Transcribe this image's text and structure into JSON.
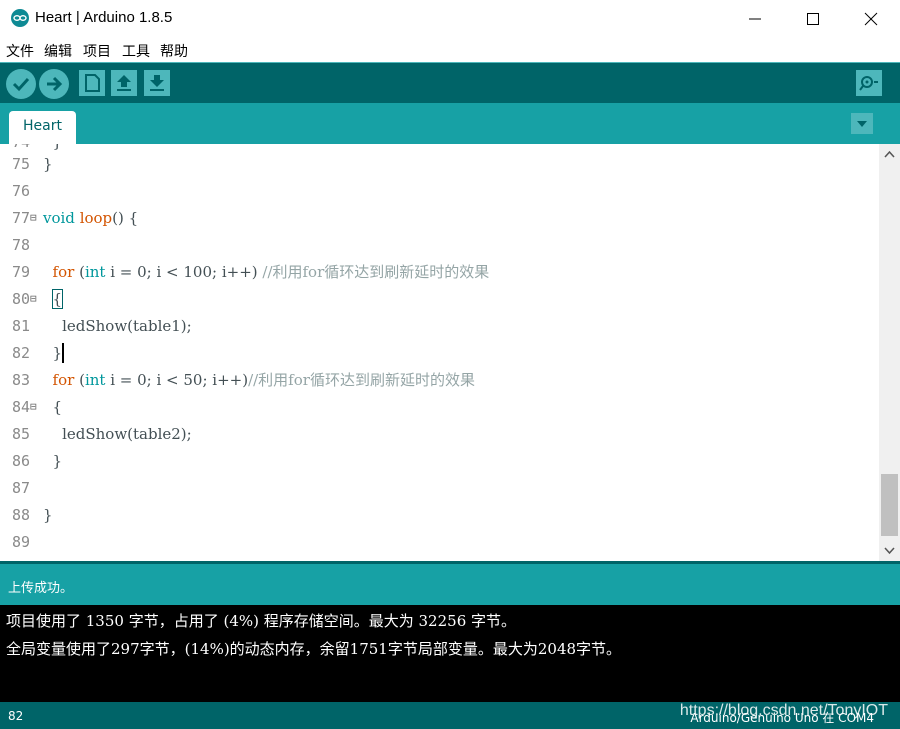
{
  "window": {
    "title": "Heart | Arduino 1.8.5",
    "icon": "arduino-logo-icon",
    "controls": [
      "minimize-icon",
      "maximize-icon",
      "close-icon"
    ]
  },
  "menu": {
    "items": [
      "文件",
      "编辑",
      "项目",
      "工具",
      "帮助"
    ]
  },
  "toolbar": {
    "buttons": [
      "verify-icon",
      "upload-icon",
      "new-icon",
      "open-icon",
      "save-icon"
    ],
    "serial_monitor": "serial-monitor-icon"
  },
  "tabs": {
    "active": "Heart",
    "menu_icon": "tab-menu-icon"
  },
  "editor": {
    "lines": [
      {
        "num": "75",
        "text": "}"
      },
      {
        "num": "76",
        "text": ""
      },
      {
        "num": "77",
        "text": "void loop() {"
      },
      {
        "num": "78",
        "text": ""
      },
      {
        "num": "79",
        "text": "  for (int i = 0; i < 100; i++) //利用for循环达到刷新延时的效果"
      },
      {
        "num": "80",
        "text": "  {"
      },
      {
        "num": "81",
        "text": "    ledShow(table1);"
      },
      {
        "num": "82",
        "text": "  }"
      },
      {
        "num": "83",
        "text": "  for (int i = 0; i < 50; i++)//利用for循环达到刷新延时的效果"
      },
      {
        "num": "84",
        "text": "  {"
      },
      {
        "num": "85",
        "text": "    ledShow(table2);"
      },
      {
        "num": "86",
        "text": "  }"
      },
      {
        "num": "87",
        "text": ""
      },
      {
        "num": "88",
        "text": "}"
      },
      {
        "num": "89",
        "text": ""
      }
    ],
    "comment": "//利用for循环达到刷新延时的效果"
  },
  "status": {
    "message": "上传成功。"
  },
  "console": {
    "lines": [
      "项目使用了 1350 字节，占用了 (4%) 程序存储空间。最大为 32256 字节。",
      "全局变量使用了297字节，(14%)的动态内存，余留1751字节局部变量。最大为2048字节。"
    ]
  },
  "footer": {
    "line_number": "82",
    "board": "Arduino/Genuino Uno 在 COM4",
    "watermark": "https://blog.csdn.net/TonyIOT"
  },
  "colors": {
    "toolbar": "#006468",
    "tabbar": "#17a1a5",
    "button": "#4db7bb",
    "keyword": "#d35400",
    "type": "#00979c",
    "comment": "#95a5a6"
  }
}
